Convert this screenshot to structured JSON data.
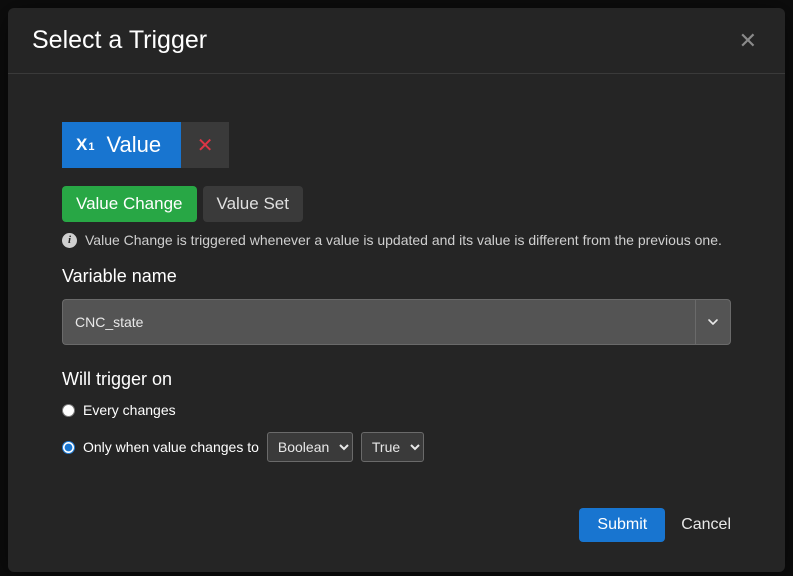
{
  "modal": {
    "title": "Select a Trigger"
  },
  "trigger": {
    "chip_label": "Value"
  },
  "tabs": {
    "value_change": "Value Change",
    "value_set": "Value Set"
  },
  "help": {
    "value_change_text": "Value Change is triggered whenever a value is updated and its value is different from the previous one."
  },
  "variable": {
    "label": "Variable name",
    "selected": "CNC_state"
  },
  "trigger_on": {
    "label": "Will trigger on",
    "every_changes": "Every changes",
    "only_when": "Only when value changes to",
    "type_select": "Boolean",
    "value_select": "True"
  },
  "footer": {
    "submit": "Submit",
    "cancel": "Cancel"
  }
}
